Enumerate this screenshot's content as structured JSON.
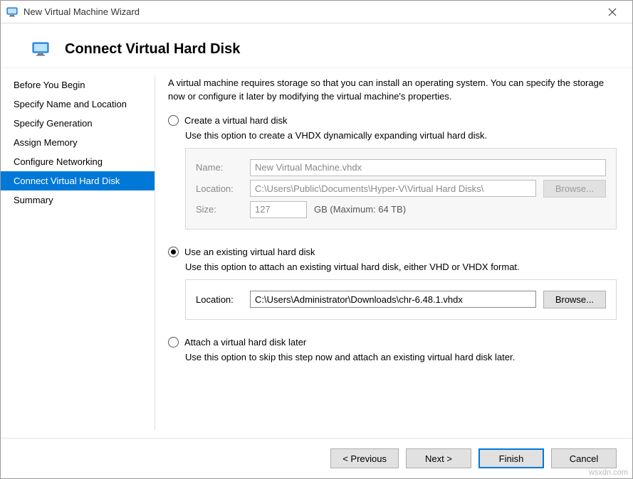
{
  "window": {
    "title": "New Virtual Machine Wizard"
  },
  "header": {
    "title": "Connect Virtual Hard Disk"
  },
  "sidebar": {
    "steps": [
      "Before You Begin",
      "Specify Name and Location",
      "Specify Generation",
      "Assign Memory",
      "Configure Networking",
      "Connect Virtual Hard Disk",
      "Summary"
    ],
    "active_index": 5
  },
  "content": {
    "intro": "A virtual machine requires storage so that you can install an operating system. You can specify the storage now or configure it later by modifying the virtual machine's properties.",
    "option_create": {
      "label": "Create a virtual hard disk",
      "desc": "Use this option to create a VHDX dynamically expanding virtual hard disk.",
      "name_label": "Name:",
      "name_value": "New Virtual Machine.vhdx",
      "location_label": "Location:",
      "location_value": "C:\\Users\\Public\\Documents\\Hyper-V\\Virtual Hard Disks\\",
      "browse_label": "Browse...",
      "size_label": "Size:",
      "size_value": "127",
      "size_hint": "GB (Maximum: 64 TB)"
    },
    "option_existing": {
      "label": "Use an existing virtual hard disk",
      "desc": "Use this option to attach an existing virtual hard disk, either VHD or VHDX format.",
      "location_label": "Location:",
      "location_value": "C:\\Users\\Administrator\\Downloads\\chr-6.48.1.vhdx",
      "browse_label": "Browse..."
    },
    "option_later": {
      "label": "Attach a virtual hard disk later",
      "desc": "Use this option to skip this step now and attach an existing virtual hard disk later."
    },
    "selected": "existing"
  },
  "footer": {
    "previous": "< Previous",
    "next": "Next >",
    "finish": "Finish",
    "cancel": "Cancel"
  },
  "watermark": "wsxdn.com"
}
